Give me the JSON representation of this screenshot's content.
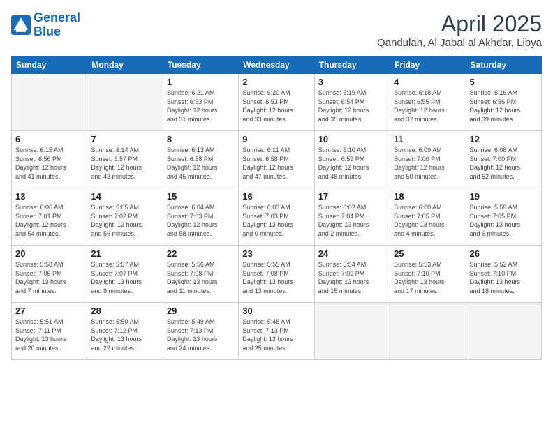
{
  "logo": {
    "line1": "General",
    "line2": "Blue"
  },
  "title": "April 2025",
  "location": "Qandulah, Al Jabal al Akhdar, Libya",
  "days_header": [
    "Sunday",
    "Monday",
    "Tuesday",
    "Wednesday",
    "Thursday",
    "Friday",
    "Saturday"
  ],
  "weeks": [
    [
      {
        "day": "",
        "info": ""
      },
      {
        "day": "",
        "info": ""
      },
      {
        "day": "1",
        "info": "Sunrise: 6:21 AM\nSunset: 6:53 PM\nDaylight: 12 hours\nand 31 minutes."
      },
      {
        "day": "2",
        "info": "Sunrise: 6:20 AM\nSunset: 6:53 PM\nDaylight: 12 hours\nand 33 minutes."
      },
      {
        "day": "3",
        "info": "Sunrise: 6:19 AM\nSunset: 6:54 PM\nDaylight: 12 hours\nand 35 minutes."
      },
      {
        "day": "4",
        "info": "Sunrise: 6:18 AM\nSunset: 6:55 PM\nDaylight: 12 hours\nand 37 minutes."
      },
      {
        "day": "5",
        "info": "Sunrise: 6:16 AM\nSunset: 6:56 PM\nDaylight: 12 hours\nand 39 minutes."
      }
    ],
    [
      {
        "day": "6",
        "info": "Sunrise: 6:15 AM\nSunset: 6:56 PM\nDaylight: 12 hours\nand 41 minutes."
      },
      {
        "day": "7",
        "info": "Sunrise: 6:14 AM\nSunset: 6:57 PM\nDaylight: 12 hours\nand 43 minutes."
      },
      {
        "day": "8",
        "info": "Sunrise: 6:13 AM\nSunset: 6:58 PM\nDaylight: 12 hours\nand 45 minutes."
      },
      {
        "day": "9",
        "info": "Sunrise: 6:11 AM\nSunset: 6:58 PM\nDaylight: 12 hours\nand 47 minutes."
      },
      {
        "day": "10",
        "info": "Sunrise: 6:10 AM\nSunset: 6:59 PM\nDaylight: 12 hours\nand 48 minutes."
      },
      {
        "day": "11",
        "info": "Sunrise: 6:09 AM\nSunset: 7:00 PM\nDaylight: 12 hours\nand 50 minutes."
      },
      {
        "day": "12",
        "info": "Sunrise: 6:08 AM\nSunset: 7:00 PM\nDaylight: 12 hours\nand 52 minutes."
      }
    ],
    [
      {
        "day": "13",
        "info": "Sunrise: 6:06 AM\nSunset: 7:01 PM\nDaylight: 12 hours\nand 54 minutes."
      },
      {
        "day": "14",
        "info": "Sunrise: 6:05 AM\nSunset: 7:02 PM\nDaylight: 12 hours\nand 56 minutes."
      },
      {
        "day": "15",
        "info": "Sunrise: 6:04 AM\nSunset: 7:03 PM\nDaylight: 12 hours\nand 58 minutes."
      },
      {
        "day": "16",
        "info": "Sunrise: 6:03 AM\nSunset: 7:03 PM\nDaylight: 13 hours\nand 0 minutes."
      },
      {
        "day": "17",
        "info": "Sunrise: 6:02 AM\nSunset: 7:04 PM\nDaylight: 13 hours\nand 2 minutes."
      },
      {
        "day": "18",
        "info": "Sunrise: 6:00 AM\nSunset: 7:05 PM\nDaylight: 13 hours\nand 4 minutes."
      },
      {
        "day": "19",
        "info": "Sunrise: 5:59 AM\nSunset: 7:05 PM\nDaylight: 13 hours\nand 6 minutes."
      }
    ],
    [
      {
        "day": "20",
        "info": "Sunrise: 5:58 AM\nSunset: 7:06 PM\nDaylight: 13 hours\nand 7 minutes."
      },
      {
        "day": "21",
        "info": "Sunrise: 5:57 AM\nSunset: 7:07 PM\nDaylight: 13 hours\nand 9 minutes."
      },
      {
        "day": "22",
        "info": "Sunrise: 5:56 AM\nSunset: 7:08 PM\nDaylight: 13 hours\nand 11 minutes."
      },
      {
        "day": "23",
        "info": "Sunrise: 5:55 AM\nSunset: 7:08 PM\nDaylight: 13 hours\nand 13 minutes."
      },
      {
        "day": "24",
        "info": "Sunrise: 5:54 AM\nSunset: 7:09 PM\nDaylight: 13 hours\nand 15 minutes."
      },
      {
        "day": "25",
        "info": "Sunrise: 5:53 AM\nSunset: 7:10 PM\nDaylight: 13 hours\nand 17 minutes."
      },
      {
        "day": "26",
        "info": "Sunrise: 5:52 AM\nSunset: 7:10 PM\nDaylight: 13 hours\nand 18 minutes."
      }
    ],
    [
      {
        "day": "27",
        "info": "Sunrise: 5:51 AM\nSunset: 7:11 PM\nDaylight: 13 hours\nand 20 minutes."
      },
      {
        "day": "28",
        "info": "Sunrise: 5:50 AM\nSunset: 7:12 PM\nDaylight: 13 hours\nand 22 minutes."
      },
      {
        "day": "29",
        "info": "Sunrise: 5:49 AM\nSunset: 7:13 PM\nDaylight: 13 hours\nand 24 minutes."
      },
      {
        "day": "30",
        "info": "Sunrise: 5:48 AM\nSunset: 7:13 PM\nDaylight: 13 hours\nand 25 minutes."
      },
      {
        "day": "",
        "info": ""
      },
      {
        "day": "",
        "info": ""
      },
      {
        "day": "",
        "info": ""
      }
    ]
  ]
}
